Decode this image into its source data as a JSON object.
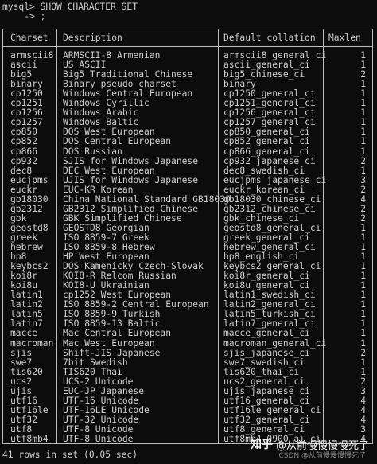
{
  "prompt": {
    "line1": "mysql> SHOW CHARACTER SET",
    "line2": "    -> ;"
  },
  "headers": {
    "charset": "Charset",
    "description": "Description",
    "collation": "Default collation",
    "maxlen": "Maxlen"
  },
  "rows": [
    [
      "armscii8",
      "ARMSCII-8 Armenian",
      "armscii8_general_ci",
      "1"
    ],
    [
      "ascii",
      "US ASCII",
      "ascii_general_ci",
      "1"
    ],
    [
      "big5",
      "Big5 Traditional Chinese",
      "big5_chinese_ci",
      "2"
    ],
    [
      "binary",
      "Binary pseudo charset",
      "binary",
      "1"
    ],
    [
      "cp1250",
      "Windows Central European",
      "cp1250_general_ci",
      "1"
    ],
    [
      "cp1251",
      "Windows Cyrillic",
      "cp1251_general_ci",
      "1"
    ],
    [
      "cp1256",
      "Windows Arabic",
      "cp1256_general_ci",
      "1"
    ],
    [
      "cp1257",
      "Windows Baltic",
      "cp1257_general_ci",
      "1"
    ],
    [
      "cp850",
      "DOS West European",
      "cp850_general_ci",
      "1"
    ],
    [
      "cp852",
      "DOS Central European",
      "cp852_general_ci",
      "1"
    ],
    [
      "cp866",
      "DOS Russian",
      "cp866_general_ci",
      "1"
    ],
    [
      "cp932",
      "SJIS for Windows Japanese",
      "cp932_japanese_ci",
      "2"
    ],
    [
      "dec8",
      "DEC West European",
      "dec8_swedish_ci",
      "1"
    ],
    [
      "eucjpms",
      "UJIS for Windows Japanese",
      "eucjpms_japanese_ci",
      "3"
    ],
    [
      "euckr",
      "EUC-KR Korean",
      "euckr_korean_ci",
      "2"
    ],
    [
      "gb18030",
      "China National Standard GB18030",
      "gb18030_chinese_ci",
      "4"
    ],
    [
      "gb2312",
      "GB2312 Simplified Chinese",
      "gb2312_chinese_ci",
      "2"
    ],
    [
      "gbk",
      "GBK Simplified Chinese",
      "gbk_chinese_ci",
      "2"
    ],
    [
      "geostd8",
      "GEOSTD8 Georgian",
      "geostd8_general_ci",
      "1"
    ],
    [
      "greek",
      "ISO 8859-7 Greek",
      "greek_general_ci",
      "1"
    ],
    [
      "hebrew",
      "ISO 8859-8 Hebrew",
      "hebrew_general_ci",
      "1"
    ],
    [
      "hp8",
      "HP West European",
      "hp8_english_ci",
      "1"
    ],
    [
      "keybcs2",
      "DOS Kamenicky Czech-Slovak",
      "keybcs2_general_ci",
      "1"
    ],
    [
      "koi8r",
      "KOI8-R Relcom Russian",
      "koi8r_general_ci",
      "1"
    ],
    [
      "koi8u",
      "KOI8-U Ukrainian",
      "koi8u_general_ci",
      "1"
    ],
    [
      "latin1",
      "cp1252 West European",
      "latin1_swedish_ci",
      "1"
    ],
    [
      "latin2",
      "ISO 8859-2 Central European",
      "latin2_general_ci",
      "1"
    ],
    [
      "latin5",
      "ISO 8859-9 Turkish",
      "latin5_turkish_ci",
      "1"
    ],
    [
      "latin7",
      "ISO 8859-13 Baltic",
      "latin7_general_ci",
      "1"
    ],
    [
      "macce",
      "Mac Central European",
      "macce_general_ci",
      "1"
    ],
    [
      "macroman",
      "Mac West European",
      "macroman_general_ci",
      "1"
    ],
    [
      "sjis",
      "Shift-JIS Japanese",
      "sjis_japanese_ci",
      "2"
    ],
    [
      "swe7",
      "7bit Swedish",
      "swe7_swedish_ci",
      "1"
    ],
    [
      "tis620",
      "TIS620 Thai",
      "tis620_thai_ci",
      "1"
    ],
    [
      "ucs2",
      "UCS-2 Unicode",
      "ucs2_general_ci",
      "2"
    ],
    [
      "ujis",
      "EUC-JP Japanese",
      "ujis_japanese_ci",
      "3"
    ],
    [
      "utf16",
      "UTF-16 Unicode",
      "utf16_general_ci",
      "4"
    ],
    [
      "utf16le",
      "UTF-16LE Unicode",
      "utf16le_general_ci",
      "4"
    ],
    [
      "utf32",
      "UTF-32 Unicode",
      "utf32_general_ci",
      "4"
    ],
    [
      "utf8",
      "UTF-8 Unicode",
      "utf8_general_ci",
      "3"
    ],
    [
      "utf8mb4",
      "UTF-8 Unicode",
      "utf8mb4_0900_ai_ci",
      "4"
    ]
  ],
  "footer": "41 rows in set (0.05 sec)",
  "watermark": {
    "logo": "知乎",
    "handle": "@从前慢慢慢慢死了",
    "csdn": "CSDN @从前慢慢慢慢死了"
  },
  "colors": {
    "background": "#0c0c0c",
    "text": "#cfcfcf",
    "border": "#bdbdbd"
  }
}
